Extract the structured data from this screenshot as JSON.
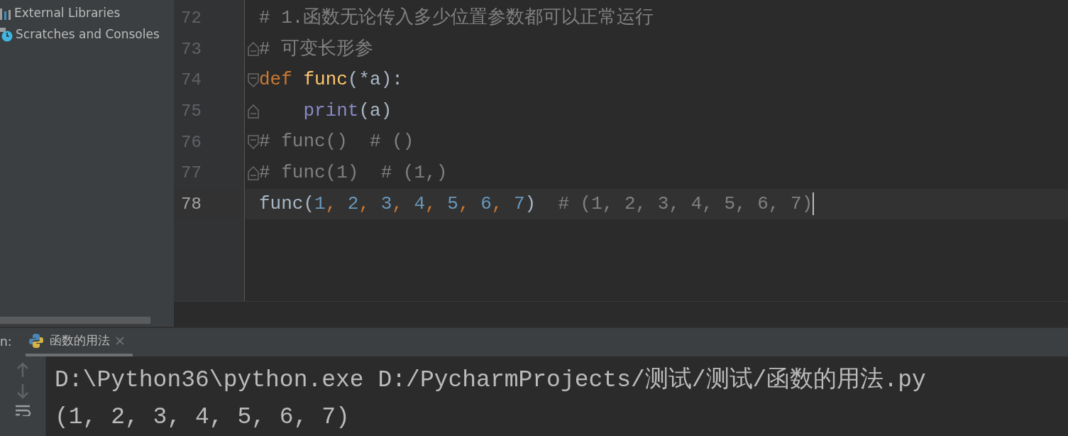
{
  "project_tree": {
    "items": [
      {
        "label": "External Libraries",
        "kind": "libraries"
      },
      {
        "label": "Scratches and Consoles",
        "kind": "scratches"
      }
    ]
  },
  "editor": {
    "lines": [
      {
        "number": "72",
        "kind": "plain",
        "current": false,
        "tokens": [
          {
            "kind": "comment",
            "text": "# 1.函数无论传入多少位置参数都可以正常运行"
          }
        ]
      },
      {
        "number": "73",
        "kind": "fold-end",
        "current": false,
        "tokens": [
          {
            "kind": "comment",
            "text": "# 可变长形参"
          }
        ]
      },
      {
        "number": "74",
        "kind": "fold-start",
        "current": false,
        "tokens": [
          {
            "kind": "keyword",
            "text": "def "
          },
          {
            "kind": "function",
            "text": "func"
          },
          {
            "kind": "plain",
            "text": "(*a):"
          }
        ]
      },
      {
        "number": "75",
        "kind": "fold-end",
        "current": false,
        "tokens": [
          {
            "kind": "builtin",
            "text": "    print"
          },
          {
            "kind": "plain",
            "text": "(a)"
          }
        ]
      },
      {
        "number": "76",
        "kind": "fold-start",
        "current": false,
        "tokens": [
          {
            "kind": "comment",
            "text": "# func()  # ()"
          }
        ]
      },
      {
        "number": "77",
        "kind": "fold-end",
        "current": false,
        "tokens": [
          {
            "kind": "comment",
            "text": "# func(1)  # (1,)"
          }
        ]
      },
      {
        "number": "78",
        "kind": "plain",
        "current": true,
        "tokens": [
          {
            "kind": "plain",
            "text": "func("
          },
          {
            "kind": "number",
            "text": "1"
          },
          {
            "kind": "comma",
            "text": ", "
          },
          {
            "kind": "number",
            "text": "2"
          },
          {
            "kind": "comma",
            "text": ", "
          },
          {
            "kind": "number",
            "text": "3"
          },
          {
            "kind": "comma",
            "text": ", "
          },
          {
            "kind": "number",
            "text": "4"
          },
          {
            "kind": "comma",
            "text": ", "
          },
          {
            "kind": "number",
            "text": "5"
          },
          {
            "kind": "comma",
            "text": ", "
          },
          {
            "kind": "number",
            "text": "6"
          },
          {
            "kind": "comma",
            "text": ", "
          },
          {
            "kind": "number",
            "text": "7"
          },
          {
            "kind": "plain",
            "text": ")  "
          },
          {
            "kind": "comment",
            "text": "# (1, 2, 3, 4, 5, 6, 7)"
          }
        ]
      }
    ]
  },
  "run_panel": {
    "label": "n:",
    "tabs": [
      {
        "label": "函数的用法",
        "selected": true
      }
    ],
    "output": [
      "D:\\Python36\\python.exe D:/PycharmProjects/测试/测试/函数的用法.py",
      "(1, 2, 3, 4, 5, 6, 7)"
    ]
  }
}
